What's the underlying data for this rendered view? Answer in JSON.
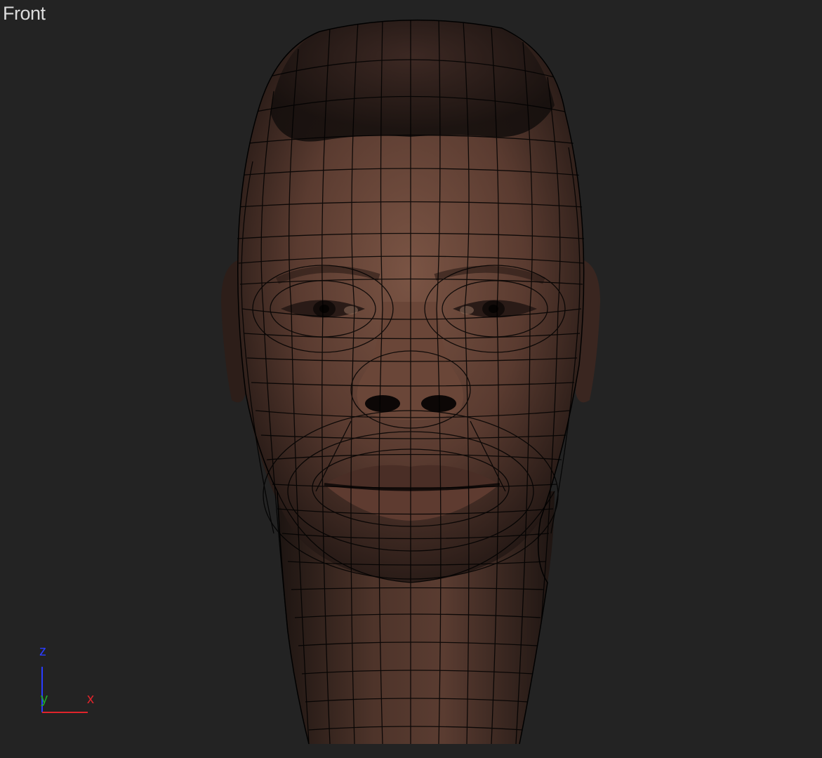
{
  "viewport": {
    "label": "Front",
    "colors": {
      "background": "#232323",
      "label_text": "#dcdcdc",
      "wire": "#000000",
      "skin": "#5a3b30",
      "skin_light": "#74503f",
      "hair": "#241714"
    }
  },
  "axis_gizmo": {
    "z_label": "z",
    "y_label": "y",
    "x_label": "x",
    "z_color": "#2a3cff",
    "y_color": "#1fae2a",
    "x_color": "#e0242b"
  }
}
